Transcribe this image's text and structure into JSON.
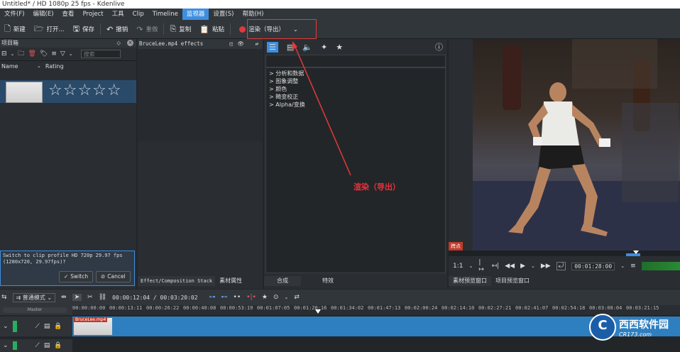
{
  "window": {
    "title": "Untitled* / HD 1080p 25 fps - Kdenlive"
  },
  "menu": [
    "文件(F)",
    "编辑(E)",
    "查看",
    "Project",
    "工具",
    "Clip",
    "Timeline",
    "监视器",
    "设置(S)",
    "帮助(H)"
  ],
  "menu_active_index": 7,
  "toolbar": {
    "new": "新建",
    "open": "打开...",
    "save": "保存",
    "undo": "撤销",
    "redo": "重做",
    "copy": "复制",
    "paste": "粘贴",
    "render": "渲染（导出）"
  },
  "bin": {
    "title": "项目箱",
    "search_placeholder": "搜索",
    "col_name": "Name",
    "col_rating": "Rating",
    "stars": "☆☆☆☆☆",
    "message": "Switch to clip profile HD 720p 29.97 fps (1280x720, 29.97fps)?",
    "switch_label": "Switch",
    "cancel_label": "Cancel"
  },
  "effects_stack": {
    "title": "BruceLee.mp4 effects",
    "tab_stack": "Effect/Composition Stack",
    "tab_props": "素材属性"
  },
  "effects_list": {
    "categories": [
      "分析和数据",
      "图象调整",
      "颜色",
      "畸变校正",
      "Alpha/变换"
    ],
    "tab_transitions": "合成",
    "tab_effects": "特效"
  },
  "monitor": {
    "badge": "跨点",
    "zoom": "1:1",
    "timecode": "00:01:28:00",
    "tab_clip": "素材预览窗口",
    "tab_project": "项目预览窗口"
  },
  "annotation": {
    "label": "渲染（导出）"
  },
  "timeline": {
    "mode": "普通模式",
    "timecode": "00:00:12:04 / 00:03:20:02",
    "ruler": [
      "00:00:00:00",
      "00:00:13:11",
      "00:00:26:22",
      "00:00:40:08",
      "00:00:53:19",
      "00:01:07:05",
      "00:01:20:16",
      "00:01:34:02",
      "00:01:47:13",
      "00:02:00:24",
      "00:02:14:10",
      "00:02:27:21",
      "00:02:41:07",
      "00:02:54:18",
      "00:03:08:04",
      "00:03:21:15"
    ],
    "master_label": "Master",
    "clip_label": "BruceLee.mp4"
  },
  "watermark": {
    "brand": "西西软件园",
    "url": "CR173.com"
  },
  "colors": {
    "accent": "#3d8ee0",
    "clip": "#2e7fc0",
    "annotation": "#e23a3a",
    "record": "#e0393f"
  }
}
